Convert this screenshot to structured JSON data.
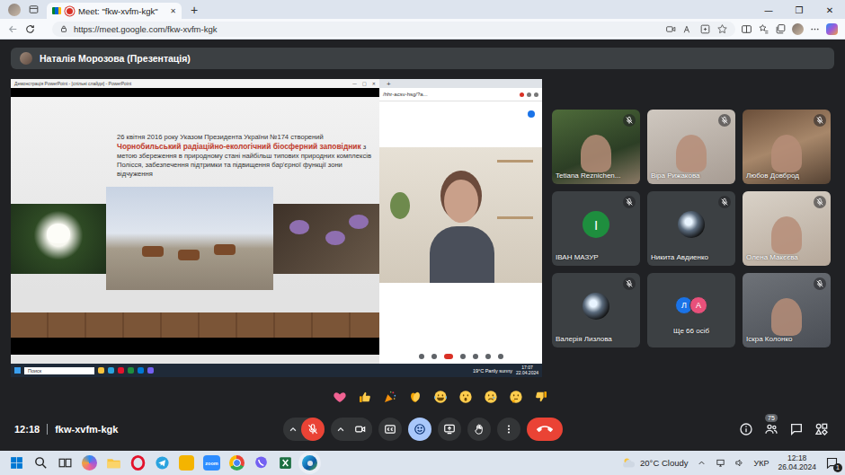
{
  "browser": {
    "tab": {
      "title": "Meet: \"fkw-xvfm-kgk\"",
      "selected": true,
      "recording": true,
      "close": "✕"
    },
    "new_tab": "+",
    "window_controls": [
      "—",
      "❐",
      "✕"
    ],
    "url": "https://meet.google.com/fkw-xvfm-kgk"
  },
  "presenter_label": "Наталія Морозова (Презентація)",
  "shared_screen": {
    "ppt_title": "Демонстрація PowerPoint - [спільні слайди] - PowerPoint",
    "ppt_window_controls": [
      "—",
      "□",
      "✕"
    ],
    "slide_text": [
      {
        "text": "26 квітня 2016 року Указом Президента України №174 створений ",
        "emphasis": false
      },
      {
        "text": "Чорнобильський радіаційно-екологічний біосферний заповідник",
        "emphasis": true
      },
      {
        "text": " з метою збереження в природному стані найбільш типових природних комплексів Полісся, забезпечення підтримки та підвищення бар'єрної функції зони відчуження",
        "emphasis": false
      }
    ],
    "chrome_new_tab": "+",
    "chrome_url": "/hhr-acsv-hsg/?a...",
    "taskbar": {
      "search": "Поиск",
      "weather": "19°C Partly sunny",
      "time": "17:07",
      "date": "22.04.2024"
    }
  },
  "participants": [
    {
      "name": "Tetiana Reznichen...",
      "kind": "video",
      "muted": true
    },
    {
      "name": "Віра Рижакова",
      "kind": "video",
      "muted": true
    },
    {
      "name": "Любов Довброд",
      "kind": "video",
      "muted": true
    },
    {
      "name": "ІВАН МАЗУР",
      "kind": "letter",
      "letter": "І",
      "color": "#1e8e3e",
      "muted": true
    },
    {
      "name": "Никита Авдиенко",
      "kind": "image",
      "muted": true
    },
    {
      "name": "Олена Макєєва",
      "kind": "video",
      "muted": true
    },
    {
      "name": "Валерія Лизлова",
      "kind": "image",
      "muted": true
    },
    {
      "name": "Ще 66 осіб",
      "kind": "more",
      "muted": false,
      "avatars": [
        {
          "letter": "Л",
          "color": "#1a73e8"
        },
        {
          "letter": "А",
          "color": "#e8507a"
        }
      ]
    },
    {
      "name": "Іскра Колонко",
      "kind": "video",
      "muted": true
    }
  ],
  "reactions": [
    {
      "kind": "heart"
    },
    {
      "kind": "thumbs-up"
    },
    {
      "kind": "party"
    },
    {
      "kind": "clap"
    },
    {
      "kind": "joy"
    },
    {
      "kind": "surprised"
    },
    {
      "kind": "sad"
    },
    {
      "kind": "thinking"
    },
    {
      "kind": "thumbs-down"
    }
  ],
  "meeting": {
    "time": "12:18",
    "code": "fkw-xvfm-kgk",
    "people_count": "75"
  },
  "controls": [
    {
      "kind": "mic",
      "highlighted": true,
      "menu": true
    },
    {
      "kind": "camera",
      "highlighted": false,
      "menu": true
    },
    {
      "kind": "captions",
      "highlighted": false,
      "menu": false
    },
    {
      "kind": "reactions",
      "highlighted": true,
      "menu": false
    },
    {
      "kind": "present",
      "highlighted": false,
      "menu": false
    },
    {
      "kind": "hand",
      "highlighted": false,
      "menu": false
    },
    {
      "kind": "more",
      "highlighted": false,
      "menu": false
    },
    {
      "kind": "leave",
      "highlighted": false,
      "menu": false
    }
  ],
  "taskbar": {
    "zoom_label": "zoom",
    "weather": "20°C Cloudy",
    "lang": "УКР",
    "time": "12:18",
    "date": "26.04.2024",
    "notifications": "1"
  }
}
